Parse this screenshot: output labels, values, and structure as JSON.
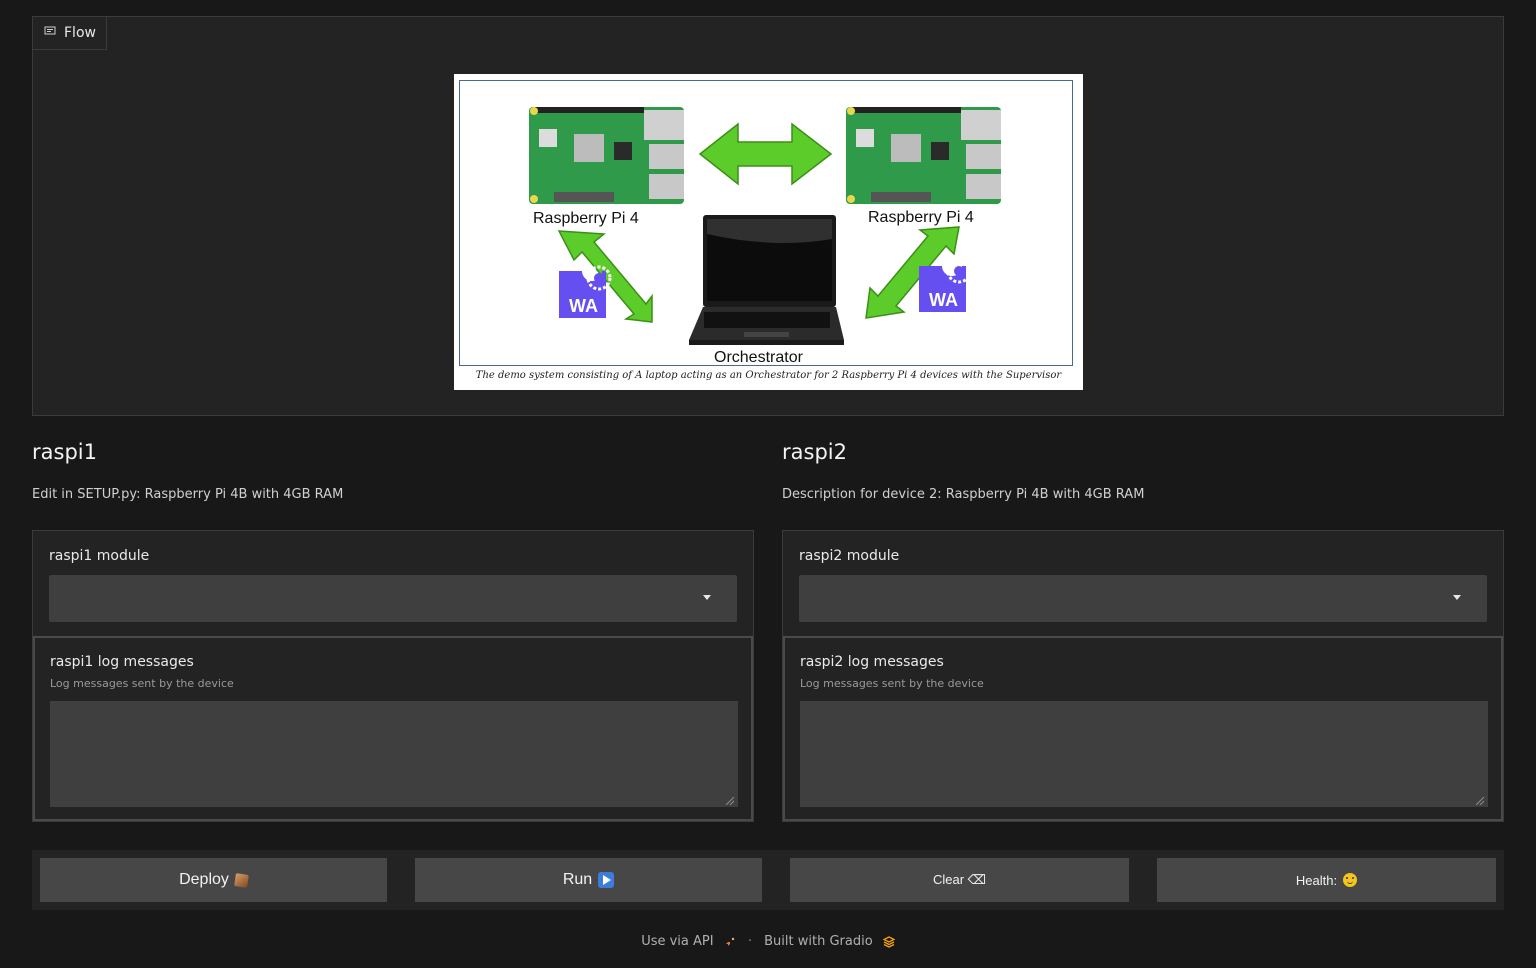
{
  "image_block": {
    "label": "Flow",
    "label_icon": "image-icon",
    "figure": {
      "left_device_label": "Raspberry Pi 4",
      "right_device_label": "Raspberry Pi 4",
      "center_label": "Orchestrator",
      "badge_text": "WA",
      "caption": "The demo system consisting of A laptop acting as an Orchestrator for 2 Raspberry Pi 4 devices with the Supervisor"
    }
  },
  "devices": [
    {
      "title": "raspi1",
      "description": "Edit in SETUP.py: Raspberry Pi 4B with 4GB RAM",
      "module_label": "raspi1 module",
      "module_value": "",
      "log_label": "raspi1 log messages",
      "log_info": "Log messages sent by the device",
      "log_value": ""
    },
    {
      "title": "raspi2",
      "description": "Description for device 2: Raspberry Pi 4B with 4GB RAM",
      "module_label": "raspi2 module",
      "module_value": "",
      "log_label": "raspi2 log messages",
      "log_info": "Log messages sent by the device",
      "log_value": ""
    }
  ],
  "buttons": {
    "deploy": "Deploy",
    "run": "Run",
    "clear": "Clear ⌫",
    "health": "Health:"
  },
  "footer": {
    "api_link": "Use via API",
    "separator": "·",
    "built_with": "Built with Gradio"
  },
  "colors": {
    "background": "#181818",
    "panel": "#232323",
    "input": "#3f3f3f",
    "button": "#474747",
    "arrow_green": "#5ccc2a"
  }
}
